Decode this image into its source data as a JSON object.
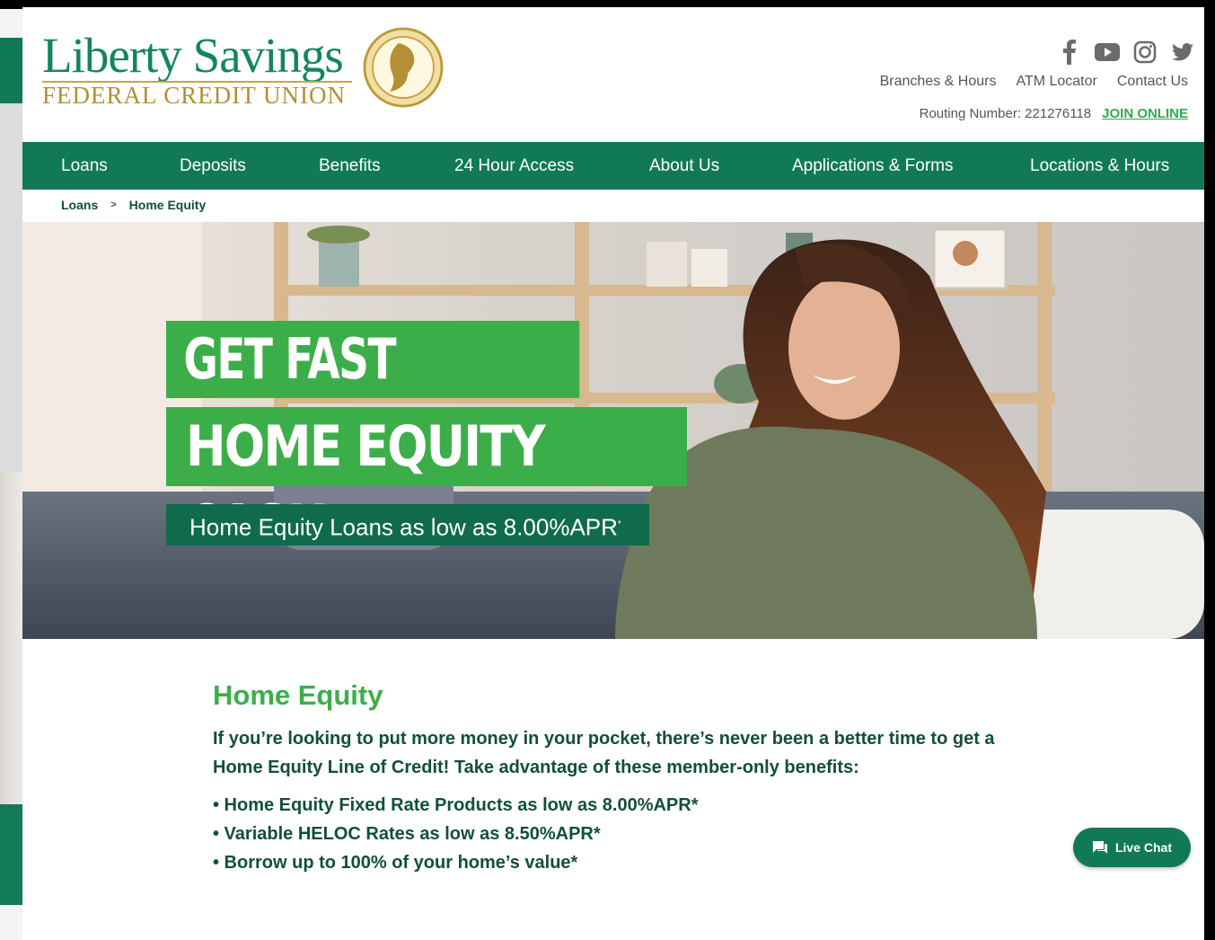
{
  "brand": {
    "name": "Liberty Savings",
    "subtitle": "FEDERAL CREDIT UNION",
    "colors": {
      "primary_green": "#117a55",
      "accent_green": "#3cae49",
      "gold": "#b48f33"
    }
  },
  "social": [
    {
      "name": "facebook-icon"
    },
    {
      "name": "youtube-icon"
    },
    {
      "name": "instagram-icon"
    },
    {
      "name": "twitter-icon"
    }
  ],
  "utility_links": [
    "Branches & Hours",
    "ATM Locator",
    "Contact Us"
  ],
  "routing": {
    "label": "Routing Number: 221276118",
    "join": "JOIN ONLINE"
  },
  "nav": [
    "Loans",
    "Deposits",
    "Benefits",
    "24 Hour Access",
    "About Us",
    "Applications & Forms",
    "Locations & Hours"
  ],
  "breadcrumb": {
    "parent": "Loans",
    "separator": ">",
    "current": "Home Equity"
  },
  "hero": {
    "line1": "GET FAST ACCESS",
    "line2": "HOME EQUITY CASH",
    "rate_text": "Home Equity Loans as low as 8.00%APR",
    "rate_mark": "*"
  },
  "content": {
    "heading": "Home Equity",
    "intro": "If you’re looking to put more money in your pocket, there’s never been a better time to get a Home Equity Line of Credit! Take advantage of these member-only benefits:",
    "bullets": [
      "• Home Equity Fixed Rate Products as low as 8.00%APR*",
      "• Variable HELOC Rates as low as 8.50%APR*",
      "• Borrow up to 100% of your home’s value*"
    ]
  },
  "chat": {
    "label": "Live Chat"
  }
}
